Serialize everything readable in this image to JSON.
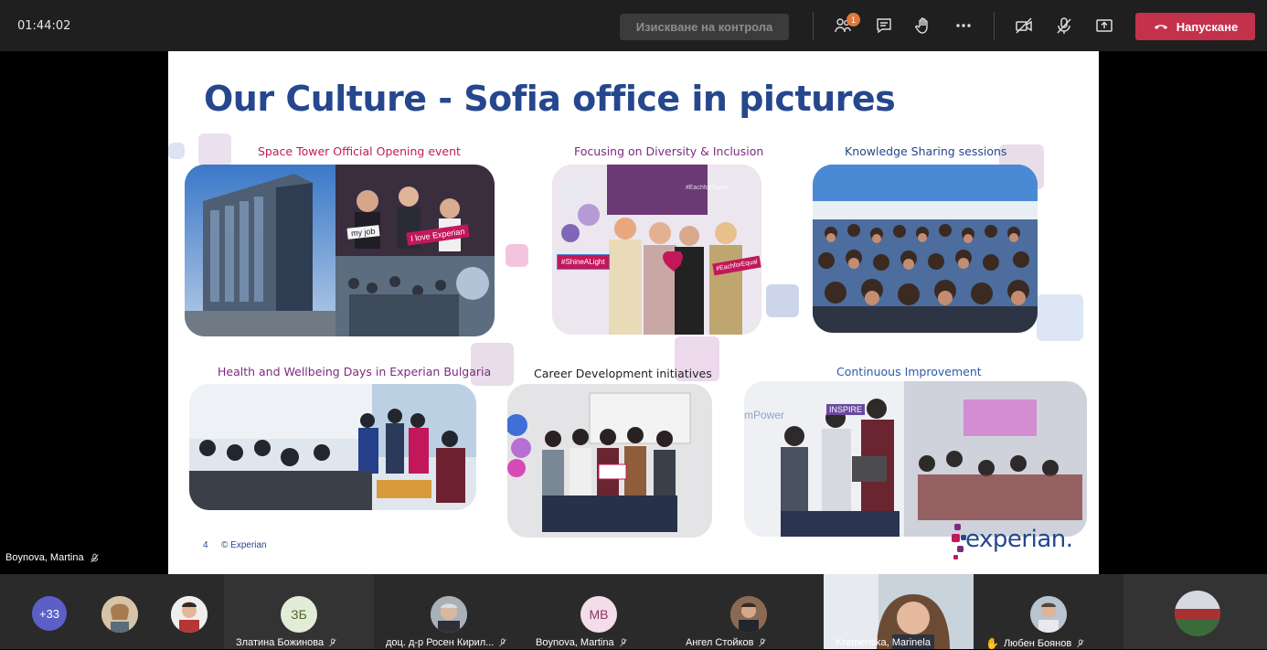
{
  "toolbar": {
    "timer": "01:44:02",
    "request_control": "Изискване на контрола",
    "participants_badge": "1",
    "leave": "Напускане",
    "icons": [
      "participants-icon",
      "chat-icon",
      "raise-hand-icon",
      "more-icon",
      "camera-off-icon",
      "mic-off-icon",
      "share-icon",
      "phone-icon"
    ]
  },
  "slide": {
    "title": "Our Culture - Sofia office in pictures",
    "captions": {
      "c1": "Space Tower Official Opening event",
      "c2": "Focusing on Diversity & Inclusion",
      "c3": "Knowledge Sharing sessions",
      "c4": "Health and Wellbeing Days in Experian Bulgaria",
      "c5": "Career Development initiatives",
      "c6": "Continuous Improvement"
    },
    "photo_signs": {
      "p1a": "I love Experian",
      "p1b": "my job",
      "p2a": "#ShineALight",
      "p2b": "#EachforEqual",
      "p2c": "#EachforEqual",
      "p6a": "mPower",
      "p6b": "INSPIRE"
    },
    "footer_page": "4",
    "footer_copy": "© Experian",
    "logo": "experian."
  },
  "presenter": {
    "name": "Boynova, Martina"
  },
  "participants": {
    "more_count": "+33",
    "tiles": [
      {
        "initials": "ЗБ",
        "name": "Златина Божинова"
      },
      {
        "initials": "",
        "name": "доц. д-р Росен Кирил..."
      },
      {
        "initials": "MB",
        "name": "Boynova, Martina"
      },
      {
        "initials": "",
        "name": "Ангел Стойков"
      },
      {
        "initials": "",
        "name": "Kremenska, Marinela"
      },
      {
        "initials": "",
        "name": "Любен Боянов"
      }
    ]
  },
  "colors": {
    "brand_blue": "#26478d",
    "caption_magenta": "#c2185b",
    "leave_red": "#c4314b",
    "purple": "#7b2a7f"
  }
}
